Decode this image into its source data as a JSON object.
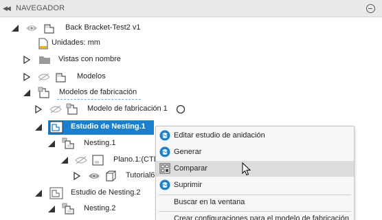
{
  "panel": {
    "title": "NAVEGADOR",
    "collapse_glyph": "◀◀"
  },
  "tree": {
    "root": "Back Bracket-Test2 v1",
    "units": "Unidades: mm",
    "named_views": "Vistas con nombre",
    "models": "Modelos",
    "manufacturing_models": "Modelos de fabricación",
    "manufacturing_model_1": "Modelo de fabricación 1",
    "nesting_study_1": "Estudio de Nesting.1",
    "nesting_1": "Nesting.1",
    "plane_1": "Plano.1:(CTD",
    "tutorial": "Tutorial6,",
    "nesting_study_2": "Estudio de Nesting.2",
    "nesting_2": "Nesting.2"
  },
  "context_menu": {
    "items": [
      {
        "label": "Editar estudio de anidación",
        "icon": "nesting-edit-icon"
      },
      {
        "label": "Generar",
        "icon": "generate-icon"
      },
      {
        "label": "Comparar",
        "icon": "compare-icon"
      },
      {
        "label": "Suprimir",
        "icon": "suppress-icon"
      },
      {
        "label": "Buscar en la ventana",
        "icon": ""
      },
      {
        "label": "Crear configuraciones para el modelo de fabricación",
        "icon": ""
      }
    ]
  },
  "colors": {
    "selection": "#1b7fcf",
    "menu_hover": "#dcdcdc",
    "menu_icon": "#1b7fcf"
  }
}
